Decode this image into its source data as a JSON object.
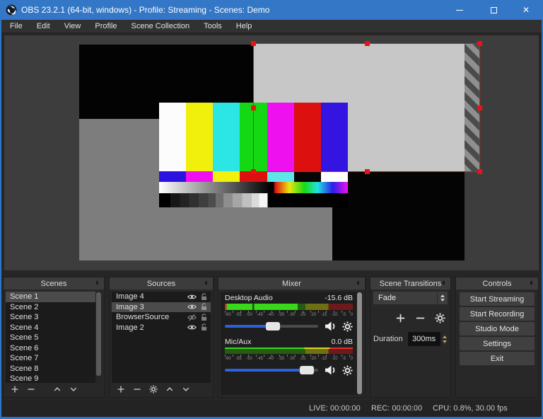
{
  "window": {
    "title": "OBS 23.2.1 (64-bit, windows) - Profile: Streaming - Scenes: Demo"
  },
  "menu": {
    "items": [
      "File",
      "Edit",
      "View",
      "Profile",
      "Scene Collection",
      "Tools",
      "Help"
    ]
  },
  "panels": {
    "scenes": {
      "title": "Scenes",
      "items": [
        "Scene 1",
        "Scene 2",
        "Scene 3",
        "Scene 4",
        "Scene 5",
        "Scene 6",
        "Scene 7",
        "Scene 8",
        "Scene 9"
      ],
      "selected": "Scene 1"
    },
    "sources": {
      "title": "Sources",
      "items": [
        {
          "name": "Image 4",
          "visible": true,
          "locked": false
        },
        {
          "name": "Image 3",
          "visible": true,
          "locked": false,
          "selected": true
        },
        {
          "name": "BrowserSource",
          "visible": false,
          "locked": false
        },
        {
          "name": "Image 2",
          "visible": true,
          "locked": false
        }
      ]
    },
    "mixer": {
      "title": "Mixer",
      "channels": [
        {
          "name": "Desktop Audio",
          "level_db": "-15.6 dB"
        },
        {
          "name": "Mic/Aux",
          "level_db": "0.0 dB"
        }
      ],
      "ticks": [
        "-60",
        "-55",
        "-50",
        "-45",
        "-40",
        "-35",
        "-30",
        "-25",
        "-20",
        "-15",
        "-10",
        "-5",
        "0"
      ]
    },
    "transitions": {
      "title": "Scene Transitions",
      "selected_transition": "Fade",
      "duration_label": "Duration",
      "duration_value": "300ms"
    },
    "controls": {
      "title": "Controls",
      "buttons": [
        "Start Streaming",
        "Start Recording",
        "Studio Mode",
        "Settings",
        "Exit"
      ]
    }
  },
  "statusbar": {
    "live": "LIVE: 00:00:00",
    "rec": "REC: 00:00:00",
    "cpu": "CPU: 0.8%, 30.00 fps"
  },
  "colors": {
    "titlebar": "#3377c6",
    "window_border": "#2e76c8",
    "selection_red": "#ec1212",
    "volume_blue": "#2d61dd"
  }
}
